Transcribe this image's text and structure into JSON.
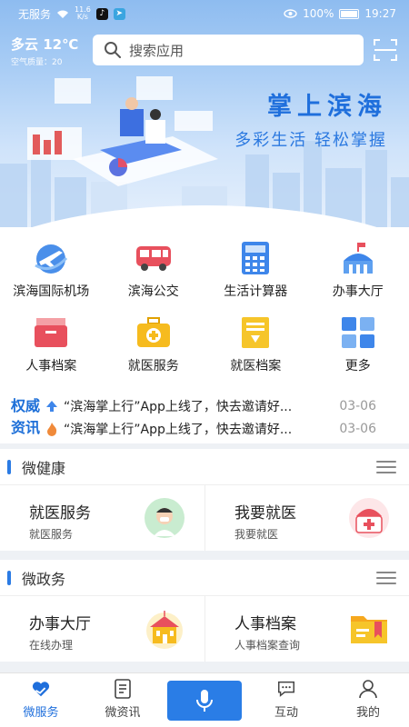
{
  "status_bar": {
    "carrier": "无服务",
    "speed": "11.6\nK/s",
    "battery": "100%",
    "time": "19:27"
  },
  "weather": {
    "main": "多云 12℃",
    "aqi": "空气质量：20"
  },
  "search": {
    "placeholder": "搜索应用"
  },
  "hero": {
    "title": "掌上滨海",
    "subtitle": "多彩生活 轻松掌握"
  },
  "quick_grid": [
    {
      "label": "滨海国际机场",
      "icon": "airplane-icon"
    },
    {
      "label": "滨海公交",
      "icon": "bus-icon"
    },
    {
      "label": "生活计算器",
      "icon": "calculator-icon"
    },
    {
      "label": "办事大厅",
      "icon": "government-hall-icon"
    },
    {
      "label": "人事档案",
      "icon": "archive-box-icon"
    },
    {
      "label": "就医服务",
      "icon": "medical-kit-icon"
    },
    {
      "label": "就医档案",
      "icon": "medical-record-icon"
    },
    {
      "label": "更多",
      "icon": "more-grid-icon"
    }
  ],
  "news": {
    "tag_line1": "权威",
    "tag_line2": "资讯",
    "items": [
      {
        "text": "“滨海掌上行”App上线了，快去邀请好...",
        "date": "03-06",
        "icon": "arrow-up-icon"
      },
      {
        "text": "“滨海掌上行”App上线了，快去邀请好...",
        "date": "03-06",
        "icon": "fire-icon"
      }
    ]
  },
  "health_card": {
    "title": "微健康",
    "cells": [
      {
        "title": "就医服务",
        "sub": "就医服务",
        "icon": "doctor-icon"
      },
      {
        "title": "我要就医",
        "sub": "我要就医",
        "icon": "medicine-bag-icon"
      }
    ]
  },
  "gov_card": {
    "title": "微政务",
    "cells": [
      {
        "title": "办事大厅",
        "sub": "在线办理",
        "icon": "building-icon"
      },
      {
        "title": "人事档案",
        "sub": "人事档案查询",
        "icon": "folder-icon"
      }
    ]
  },
  "bottom_nav": {
    "items": [
      {
        "label": "微服务",
        "icon": "heart-hand-icon",
        "active": true
      },
      {
        "label": "微资讯",
        "icon": "document-icon"
      },
      {
        "label": "互动",
        "icon": "chat-bubble-icon"
      },
      {
        "label": "我的",
        "icon": "person-icon"
      }
    ]
  },
  "colors": {
    "accent": "#2a7de6",
    "title_blue": "#1f6fdc"
  }
}
